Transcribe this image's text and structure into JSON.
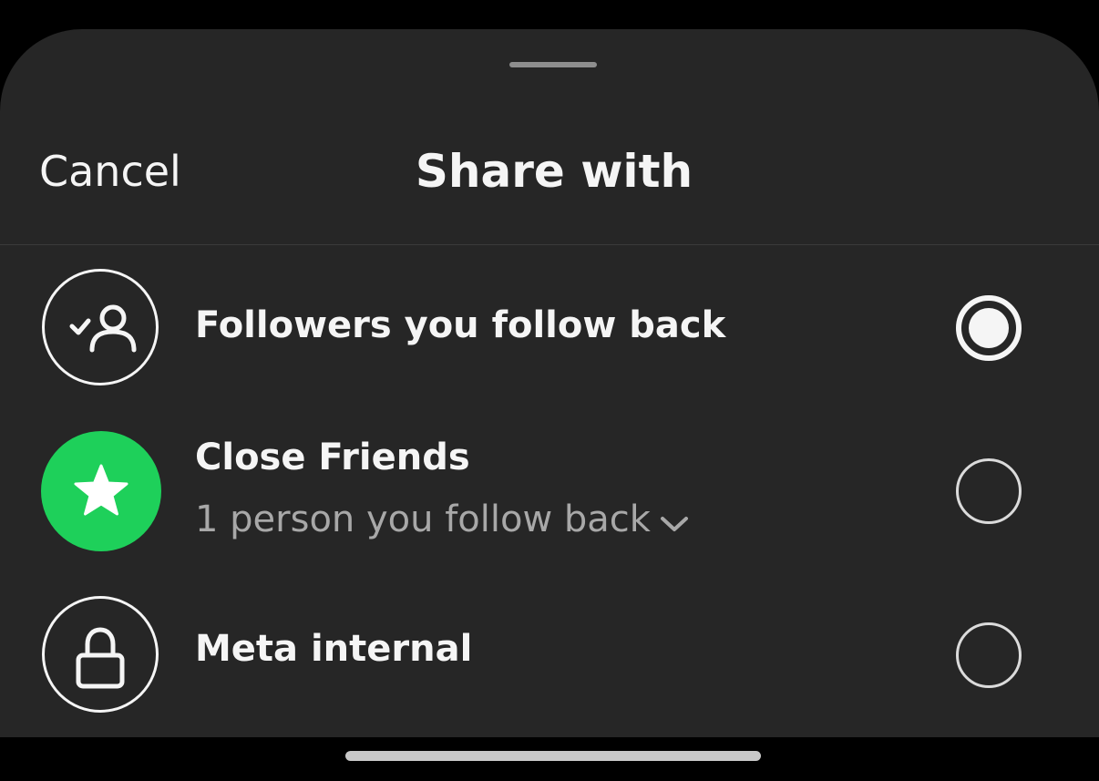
{
  "header": {
    "cancel_label": "Cancel",
    "title": "Share with"
  },
  "options": [
    {
      "label": "Followers you follow back",
      "icon": "person-check-icon",
      "selected": true
    },
    {
      "label": "Close Friends",
      "sublabel": "1 person you follow back",
      "icon": "star-icon",
      "icon_background": "#1ed05a",
      "selected": false
    },
    {
      "label": "Meta internal",
      "icon": "lock-icon",
      "selected": false
    }
  ],
  "colors": {
    "sheet_background": "#262626",
    "text_primary": "#f5f5f5",
    "text_secondary": "#a8a8a8",
    "close_friends_green": "#1ed05a"
  }
}
